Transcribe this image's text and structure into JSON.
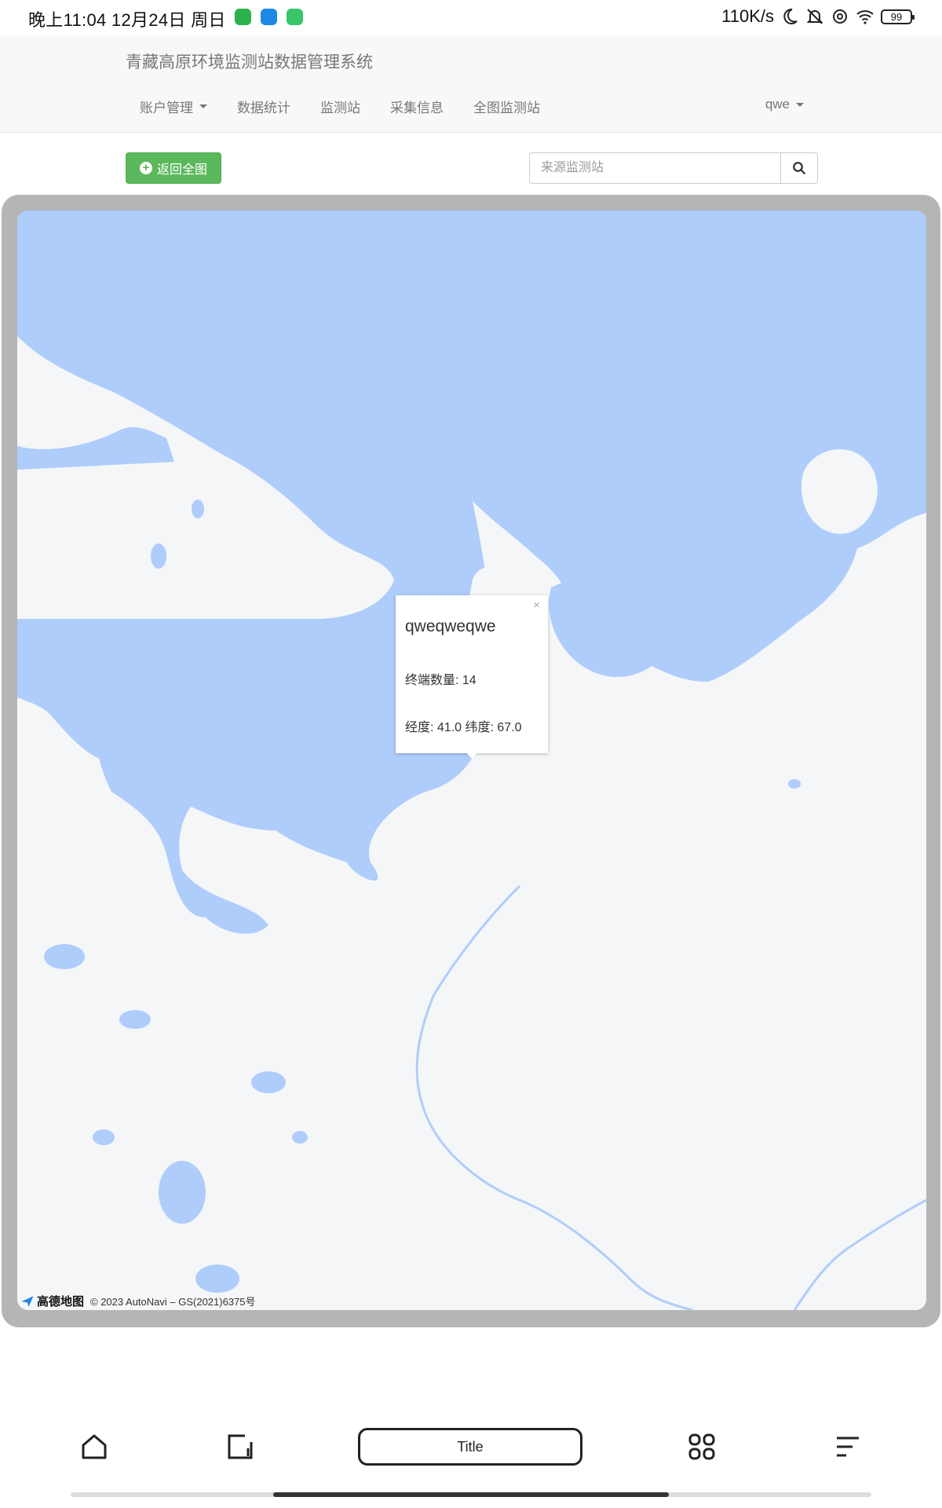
{
  "status_bar": {
    "time": "晚上11:04 12月24日 周日",
    "network_speed": "110K/s",
    "battery": "99",
    "app_icons": [
      "wechat-icon",
      "qq-browser-icon",
      "message-app-icon"
    ],
    "app_colors": [
      "#2bb24c",
      "#1e88e5",
      "#3ac569"
    ]
  },
  "navbar": {
    "brand": "青藏高原环境监测站数据管理系统",
    "items": [
      {
        "label": "账户管理",
        "dropdown": true
      },
      {
        "label": "数据统计",
        "dropdown": false
      },
      {
        "label": "监测站",
        "dropdown": false
      },
      {
        "label": "采集信息",
        "dropdown": false
      },
      {
        "label": "全图监测站",
        "dropdown": false
      }
    ],
    "user": "qwe"
  },
  "toolbar": {
    "back_label": "返回全图",
    "search_placeholder": "来源监测站"
  },
  "map": {
    "popup": {
      "title": "qweqweqwe",
      "close": "×",
      "terminal_count": "终端数量: 14",
      "coords": "经度: 41.0 纬度: 67.0"
    },
    "attribution_logo": "高德地图",
    "attribution_text": "© 2023 AutoNavi – GS(2021)6375号",
    "colors": {
      "water": "#afcdfb",
      "land": "#f5f6f7",
      "frame": "#b5b5b5"
    }
  },
  "bottom_nav": {
    "title_label": "Title",
    "icons": [
      "home-icon",
      "tabs-icon",
      "apps-icon",
      "menu-icon"
    ]
  }
}
